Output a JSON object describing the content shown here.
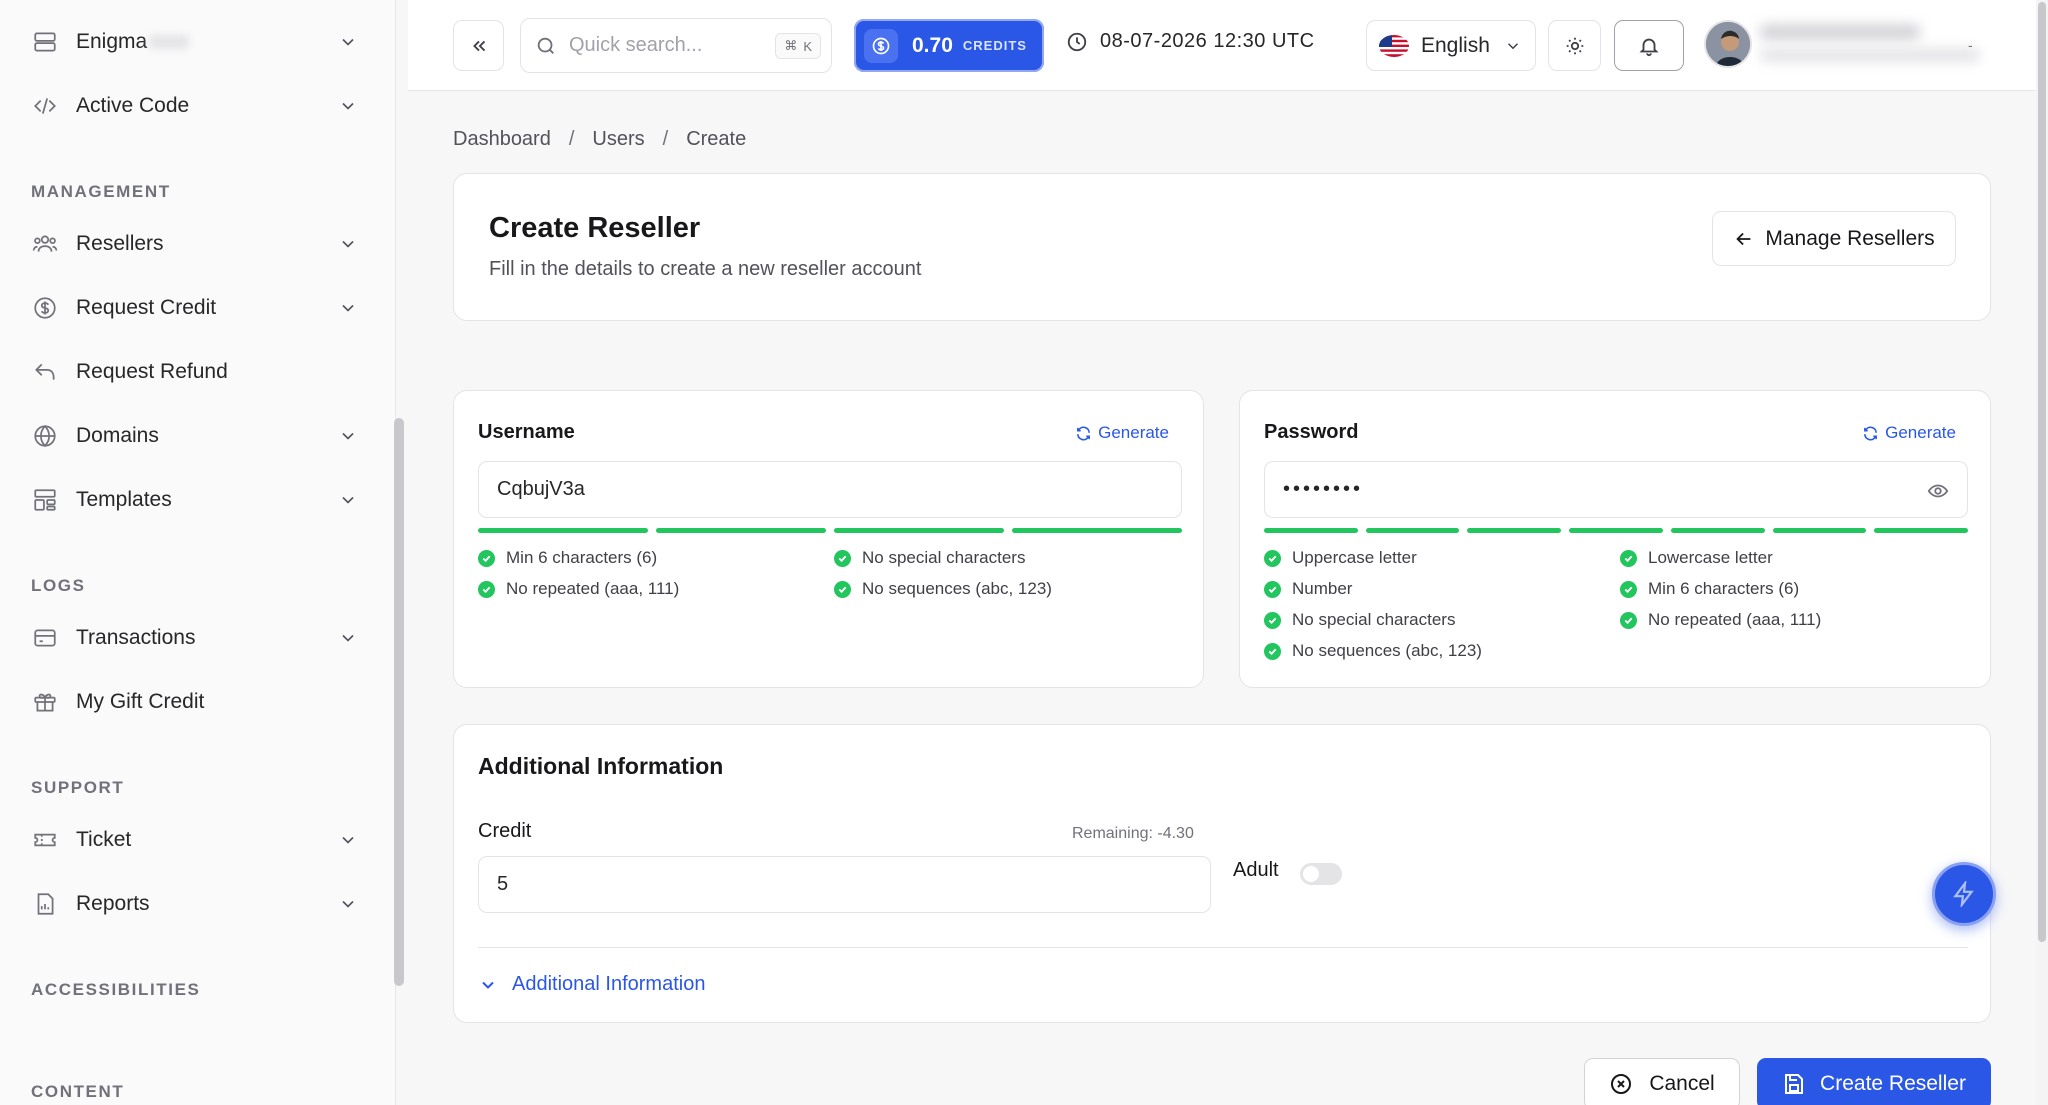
{
  "sidebar": {
    "items": [
      {
        "label": "Enigma",
        "icon": "server-icon"
      },
      {
        "label": "Active Code",
        "icon": "code-icon"
      },
      {
        "label": "Resellers",
        "icon": "users-icon"
      },
      {
        "label": "Request Credit",
        "icon": "dollar-circle-icon"
      },
      {
        "label": "Request Refund",
        "icon": "undo-icon"
      },
      {
        "label": "Domains",
        "icon": "globe-icon"
      },
      {
        "label": "Templates",
        "icon": "layout-icon"
      },
      {
        "label": "Transactions",
        "icon": "card-icon"
      },
      {
        "label": "My Gift Credit",
        "icon": "gift-icon"
      },
      {
        "label": "Ticket",
        "icon": "ticket-icon"
      },
      {
        "label": "Reports",
        "icon": "report-icon"
      }
    ],
    "sections": {
      "management": "MANAGEMENT",
      "logs": "LOGS",
      "support": "SUPPORT",
      "accessibilities": "ACCESSIBILITIES",
      "content": "CONTENT"
    }
  },
  "topbar": {
    "search_placeholder": "Quick search...",
    "search_shortcut_key": "K",
    "credits_amount": "0.70",
    "credits_unit": "CREDITS",
    "datetime": "08-07-2026 12:30 UTC",
    "language": "English",
    "user_chevron": "-"
  },
  "breadcrumb": [
    "Dashboard",
    "Users",
    "Create"
  ],
  "header": {
    "title": "Create Reseller",
    "subtitle": "Fill in the details to create a new reseller account",
    "manage_label": "Manage Resellers"
  },
  "username": {
    "label": "Username",
    "generate_label": "Generate",
    "value": "CqbujV3a",
    "strength_bars": 4,
    "rules": [
      "Min 6 characters (6)",
      "No special characters",
      "No repeated (aaa, 111)",
      "No sequences (abc, 123)"
    ]
  },
  "password": {
    "label": "Password",
    "generate_label": "Generate",
    "value": "••••••••",
    "strength_bars": 7,
    "rules": [
      "Uppercase letter",
      "Lowercase letter",
      "Number",
      "Min 6 characters (6)",
      "No special characters",
      "No repeated (aaa, 111)",
      "No sequences (abc, 123)"
    ]
  },
  "additional": {
    "title": "Additional Information",
    "credit_label": "Credit",
    "remaining": "Remaining: -4.30",
    "credit_value": "5",
    "adult_label": "Adult",
    "adult_on": false,
    "collapse_label": "Additional Information"
  },
  "actions": {
    "cancel": "Cancel",
    "create": "Create Reseller"
  },
  "colors": {
    "accent": "#2a57e6",
    "success": "#22c55e"
  }
}
